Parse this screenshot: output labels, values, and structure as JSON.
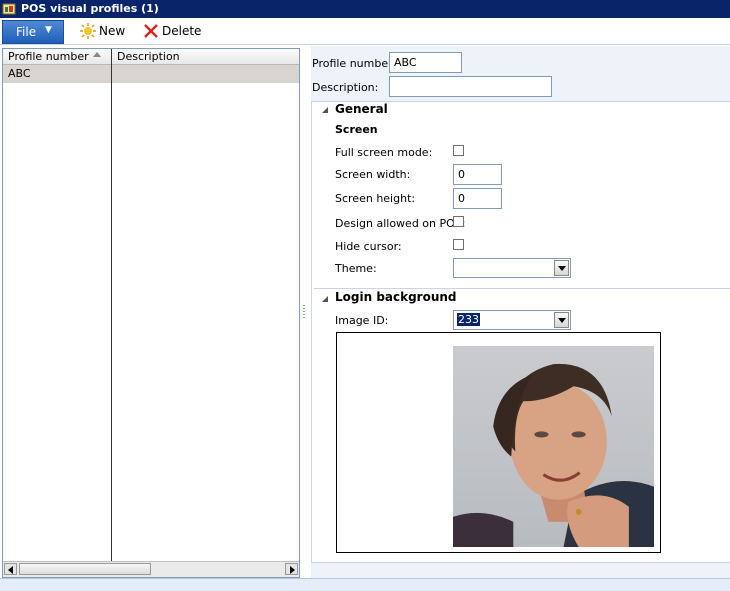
{
  "window": {
    "title": "POS visual profiles (1)"
  },
  "toolbar": {
    "file_label": "File",
    "new_label": "New",
    "delete_label": "Delete"
  },
  "grid": {
    "columns": [
      "Profile number",
      "Description"
    ],
    "rows": [
      {
        "profile_number": "ABC",
        "description": ""
      }
    ]
  },
  "form": {
    "profile_number_label": "Profile number:",
    "profile_number_value": "ABC",
    "description_label": "Description:",
    "description_value": "",
    "general": {
      "title": "General",
      "screen_heading": "Screen",
      "full_screen_label": "Full screen mode:",
      "full_screen_checked": false,
      "screen_width_label": "Screen width:",
      "screen_width_value": "0",
      "screen_height_label": "Screen height:",
      "screen_height_value": "0",
      "design_allowed_label": "Design allowed on POS:",
      "design_allowed_checked": false,
      "hide_cursor_label": "Hide cursor:",
      "hide_cursor_checked": false,
      "theme_label": "Theme:",
      "theme_value": ""
    },
    "login_background": {
      "title": "Login background",
      "image_id_label": "Image ID:",
      "image_id_value": "233"
    }
  },
  "colors": {
    "titlebar": "#0a246a",
    "file_button": "#1e5fb7",
    "selected_row": "#d8d4d0"
  },
  "icons": [
    "app-icon",
    "new-icon",
    "delete-icon",
    "sort-ascending-icon",
    "collapse-icon",
    "dropdown-arrow-icon"
  ]
}
